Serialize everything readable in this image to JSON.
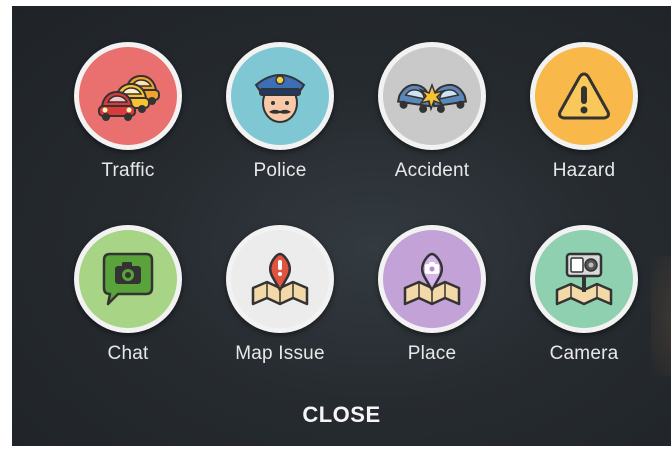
{
  "report_menu": {
    "items": [
      {
        "label": "Traffic",
        "icon": "traffic-icon",
        "color": "#ea6f6f"
      },
      {
        "label": "Police",
        "icon": "police-icon",
        "color": "#7fc7d2"
      },
      {
        "label": "Accident",
        "icon": "accident-icon",
        "color": "#c9c9c9"
      },
      {
        "label": "Hazard",
        "icon": "hazard-icon",
        "color": "#f8b84a"
      },
      {
        "label": "Chat",
        "icon": "chat-icon",
        "color": "#a8d486"
      },
      {
        "label": "Map Issue",
        "icon": "map-issue-icon",
        "color": "#ececec"
      },
      {
        "label": "Place",
        "icon": "place-icon",
        "color": "#c3a2d8"
      },
      {
        "label": "Camera",
        "icon": "camera-icon",
        "color": "#8fd0b0"
      }
    ],
    "close_label": "CLOSE"
  }
}
